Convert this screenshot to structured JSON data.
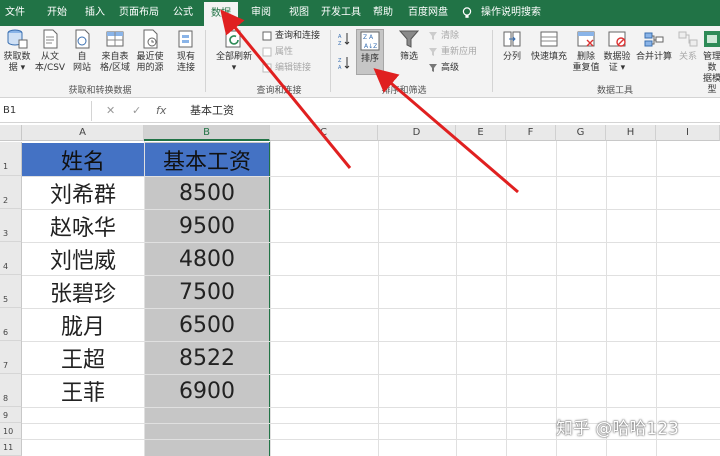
{
  "ribbon_tabs": [
    "文件",
    "开始",
    "插入",
    "页面布局",
    "公式",
    "数据",
    "审阅",
    "视图",
    "开发工具",
    "帮助",
    "百度网盘",
    "操作说明搜索"
  ],
  "active_tab": "数据",
  "ribbon": {
    "get_data": {
      "label_line1": "获取数",
      "label_line2": "据 ▾"
    },
    "from_text": {
      "label_line1": "从文",
      "label_line2": "本/CSV"
    },
    "from_web": {
      "label_line1": "自",
      "label_line2": "网站"
    },
    "from_table": {
      "label_line1": "来自表",
      "label_line2": "格/区域"
    },
    "recent_sources": {
      "label_line1": "最近使",
      "label_line2": "用的源"
    },
    "existing_conn": {
      "label_line1": "现有",
      "label_line2": "连接"
    },
    "group_get_transform": "获取和转换数据",
    "refresh_all": {
      "label_line1": "全部刷新",
      "label_line2": "▾"
    },
    "queries_connections": "查询和连接",
    "properties": "属性",
    "edit_links": "编辑链接",
    "group_queries": "查询和连接",
    "sort_asc_icon_text": "A↓Z",
    "sort": "排序",
    "filter": "筛选",
    "clear": "清除",
    "reapply": "重新应用",
    "advanced": "高级",
    "group_sort_filter": "排序和筛选",
    "text_to_columns": "分列",
    "flash_fill": "快速填充",
    "remove_duplicates": {
      "label_line1": "删除",
      "label_line2": "重复值"
    },
    "data_validation": {
      "label_line1": "数据验",
      "label_line2": "证 ▾"
    },
    "consolidate": "合并计算",
    "relationships": "关系",
    "manage_model": {
      "label_line1": "管理数",
      "label_line2": "据模型"
    },
    "group_data_tools": "数据工具"
  },
  "formula_bar": {
    "name_box": "B1",
    "cancel": "✕",
    "enter": "✓",
    "fx": "fx",
    "content": "基本工资"
  },
  "columns": [
    "A",
    "B",
    "C",
    "D",
    "E",
    "F",
    "G",
    "H",
    "I"
  ],
  "rows": [
    "1",
    "2",
    "3",
    "4",
    "5",
    "6",
    "7",
    "8",
    "9",
    "10",
    "11"
  ],
  "table": {
    "headers": [
      "姓名",
      "基本工资"
    ],
    "data": [
      [
        "刘希群",
        "8500"
      ],
      [
        "赵咏华",
        "9500"
      ],
      [
        "刘恺威",
        "4800"
      ],
      [
        "张碧珍",
        "7500"
      ],
      [
        "胧月",
        "6500"
      ],
      [
        "王超",
        "8522"
      ],
      [
        "王菲",
        "6900"
      ]
    ]
  },
  "colors": {
    "ribbon_green": "#217346",
    "header_fill": "#4472c4",
    "selection_gray": "#c6c6c6",
    "arrow_red": "#e02020"
  },
  "watermark": "知乎 @哈哈123"
}
